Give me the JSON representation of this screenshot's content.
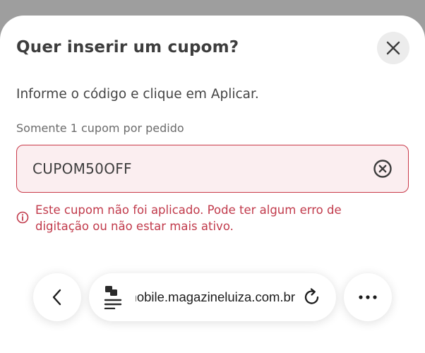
{
  "modal": {
    "title": "Quer inserir um cupom?",
    "instruction": "Informe o código e clique em Aplicar.",
    "limit_label": "Somente 1 cupom por pedido",
    "coupon_value": "CUPOM50OFF",
    "error_message": "Este cupom não foi aplicado. Pode ter algum erro de digitação ou não estar mais ativo.",
    "close_icon": "close-icon",
    "clear_icon": "clear-circle-icon",
    "error_icon": "info-circle-icon"
  },
  "browser": {
    "url": "mobile.magazineluiza.com.br",
    "back_icon": "chevron-left-icon",
    "page_icon": "page-menu-icon",
    "reload_icon": "reload-icon",
    "more_icon": "more-dots-icon"
  },
  "colors": {
    "error": "#c13a4b",
    "field_bg": "#fbeef0",
    "title": "#3d3d3d",
    "backdrop": "#9e9e9e"
  }
}
